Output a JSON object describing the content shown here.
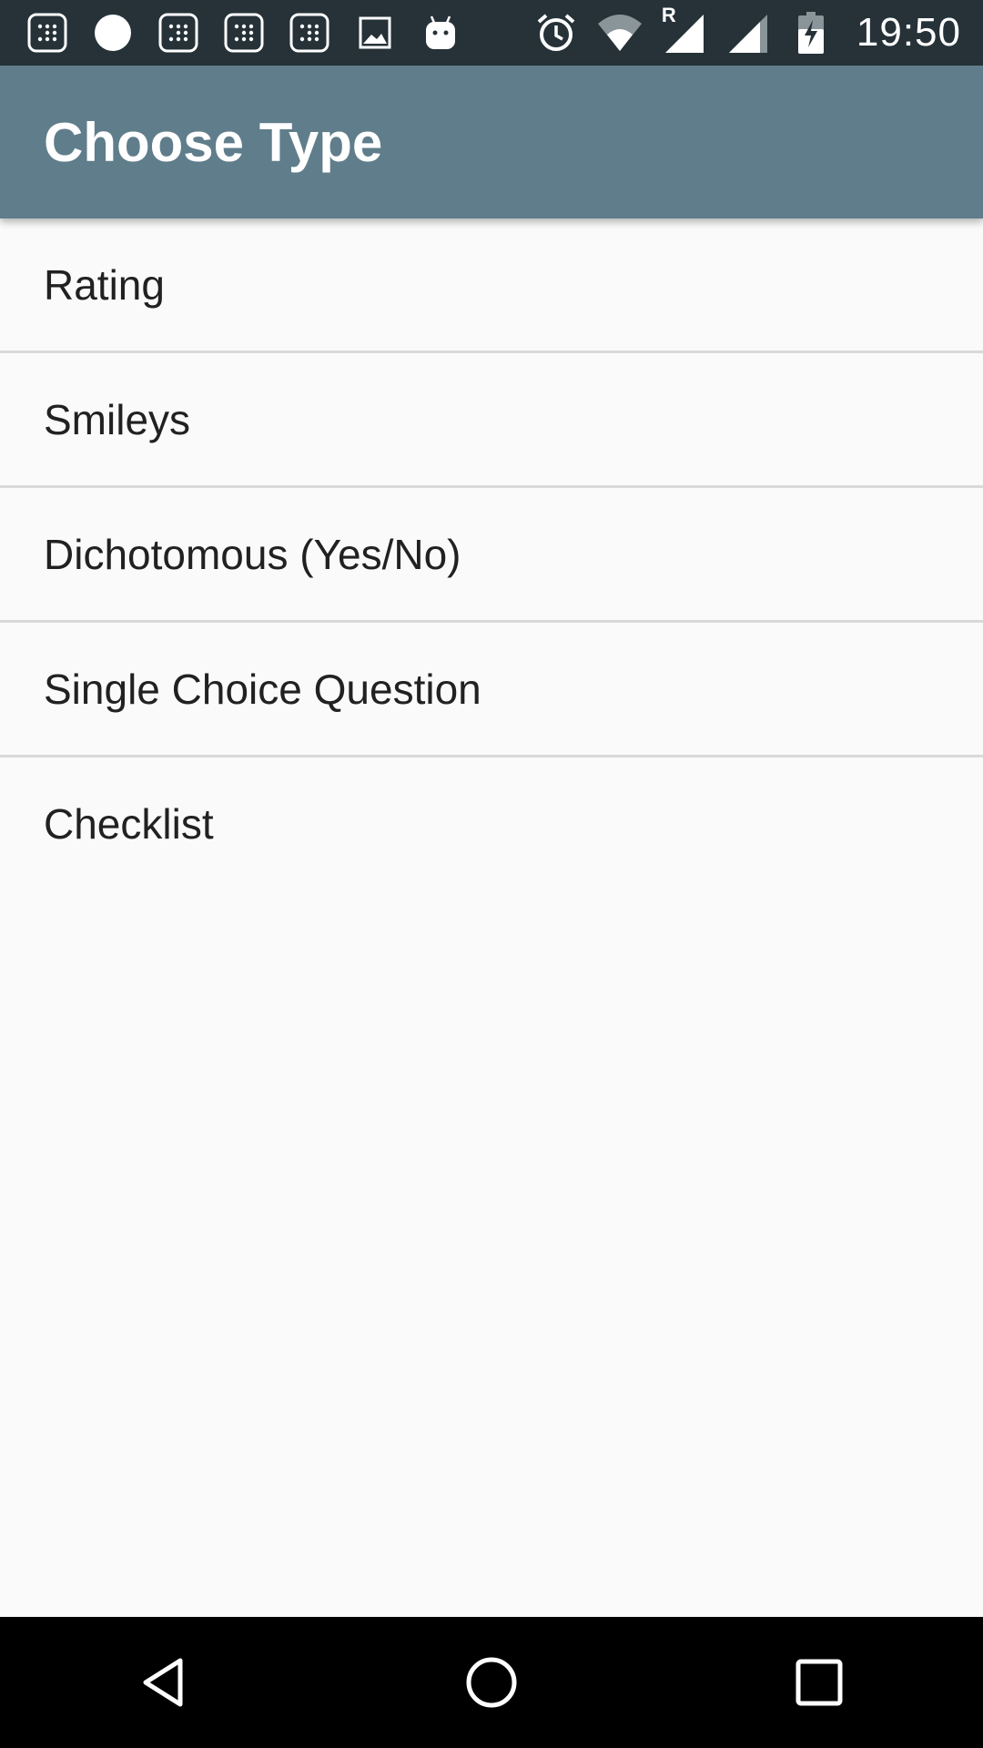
{
  "status_bar": {
    "notification_icons": [
      "app-notification-icon",
      "circle-notification-icon",
      "app-notification-icon",
      "app-notification-icon",
      "app-notification-icon",
      "image-notification-icon",
      "android-debug-icon"
    ],
    "system_icons": [
      "alarm-icon",
      "wifi-icon",
      "signal-roaming-icon",
      "signal-icon",
      "battery-charging-icon"
    ],
    "roaming_indicator": "R",
    "time": "19:50"
  },
  "app_bar": {
    "title": "Choose Type",
    "color": "#607d8b"
  },
  "type_list": {
    "items": [
      {
        "label": "Rating"
      },
      {
        "label": "Smileys"
      },
      {
        "label": "Dichotomous (Yes/No)"
      },
      {
        "label": "Single Choice Question"
      },
      {
        "label": "Checklist"
      }
    ]
  },
  "nav_bar": {
    "buttons": [
      "back-icon",
      "home-icon",
      "recents-icon"
    ]
  }
}
